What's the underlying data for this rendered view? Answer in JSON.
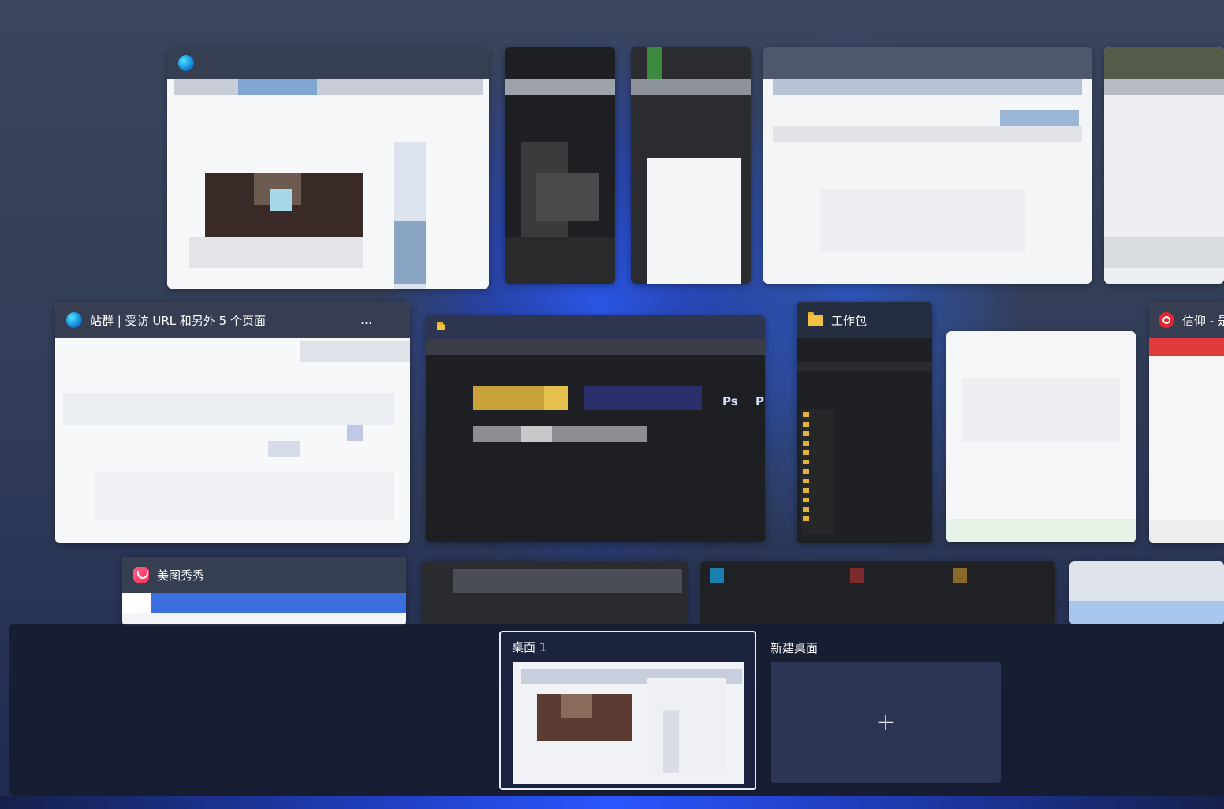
{
  "windows": [
    {
      "id": "edge-top",
      "title": ""
    },
    {
      "id": "settings-top",
      "title": ""
    },
    {
      "id": "edge-main",
      "title": "站群 | 受访 URL 和另外 5 个页面",
      "title_suffix": "…"
    },
    {
      "id": "explorer-dark",
      "title": ""
    },
    {
      "id": "explorer-work",
      "title": "工作包"
    },
    {
      "id": "netease",
      "title": "信仰 - 是"
    },
    {
      "id": "meitu",
      "title": "美图秀秀"
    }
  ],
  "explorer_labels": {
    "ps1": "Ps",
    "ps2": "P"
  },
  "desktops": {
    "current_label": "桌面 1",
    "new_label": "新建桌面",
    "plus": "+"
  },
  "colors": {
    "accent_blue": "#2b55ff",
    "tray_bg": "#161c30",
    "folder_yellow": "#f2c342"
  }
}
